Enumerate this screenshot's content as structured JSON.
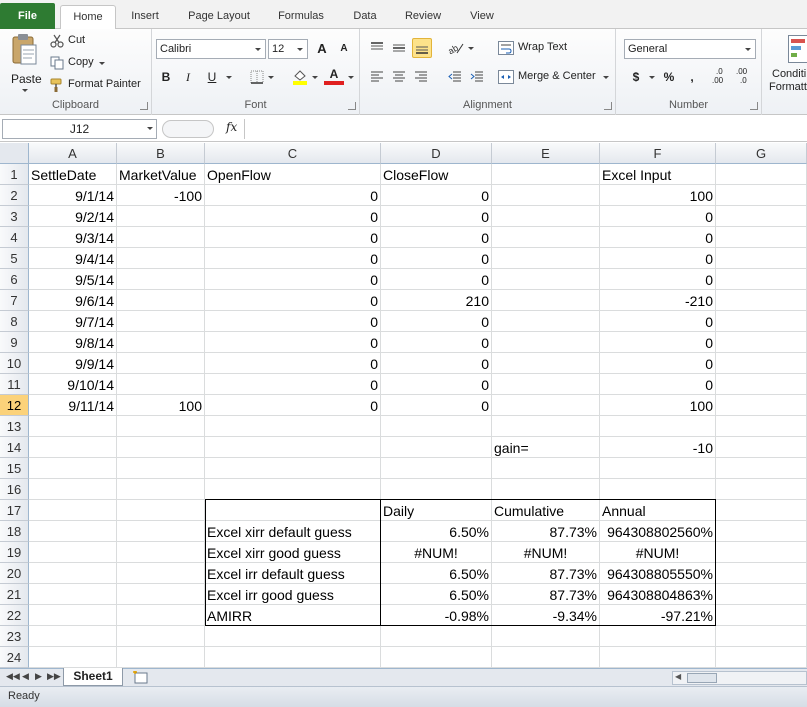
{
  "tabs": [
    "File",
    "Home",
    "Insert",
    "Page Layout",
    "Formulas",
    "Data",
    "Review",
    "View"
  ],
  "active_tab": "Home",
  "ribbon": {
    "clipboard": {
      "paste": "Paste",
      "cut": "Cut",
      "copy": "Copy",
      "format_painter": "Format Painter",
      "label": "Clipboard"
    },
    "font": {
      "name": "Calibri",
      "size": "12",
      "grow": "A",
      "shrink": "A",
      "bold": "B",
      "italic": "I",
      "underline": "U",
      "font_color": "A",
      "label": "Font"
    },
    "alignment": {
      "wrap_text": "Wrap Text",
      "merge_center": "Merge & Center",
      "label": "Alignment"
    },
    "number": {
      "format": "General",
      "currency": "$",
      "percent": "%",
      "comma": ",",
      "inc_decimal": ".00",
      "dec_decimal": ".0",
      "label": "Number"
    },
    "styles": {
      "conditional": "Conditi",
      "formatting": "Formatti"
    }
  },
  "formula_bar": {
    "name_box": "J12",
    "fx": "fx",
    "formula": ""
  },
  "columns": [
    "A",
    "B",
    "C",
    "D",
    "E",
    "F",
    "G"
  ],
  "rows": [
    "1",
    "2",
    "3",
    "4",
    "5",
    "6",
    "7",
    "8",
    "9",
    "10",
    "11",
    "12",
    "13",
    "14",
    "15",
    "16",
    "17",
    "18",
    "19",
    "20",
    "21",
    "22",
    "23",
    "24"
  ],
  "selected_row": "12",
  "cells": {
    "A1": "SettleDate",
    "B1": "MarketValue",
    "C1": "OpenFlow",
    "D1": "CloseFlow",
    "F1": "Excel Input",
    "A2": "9/1/14",
    "B2": "-100",
    "C2": "0",
    "D2": "0",
    "F2": "100",
    "A3": "9/2/14",
    "C3": "0",
    "D3": "0",
    "F3": "0",
    "A4": "9/3/14",
    "C4": "0",
    "D4": "0",
    "F4": "0",
    "A5": "9/4/14",
    "C5": "0",
    "D5": "0",
    "F5": "0",
    "A6": "9/5/14",
    "C6": "0",
    "D6": "0",
    "F6": "0",
    "A7": "9/6/14",
    "C7": "0",
    "D7": "210",
    "F7": "-210",
    "A8": "9/7/14",
    "C8": "0",
    "D8": "0",
    "F8": "0",
    "A9": "9/8/14",
    "C9": "0",
    "D9": "0",
    "F9": "0",
    "A10": "9/9/14",
    "C10": "0",
    "D10": "0",
    "F10": "0",
    "A11": "9/10/14",
    "C11": "0",
    "D11": "0",
    "F11": "0",
    "A12": "9/11/14",
    "B12": "100",
    "C12": "0",
    "D12": "0",
    "F12": "100",
    "E14": "gain=",
    "F14": "-10",
    "D17": "Daily",
    "E17": "Cumulative",
    "F17": "Annual",
    "C18": "Excel xirr default guess",
    "D18": "6.50%",
    "E18": "87.73%",
    "F18": "964308802560%",
    "C19": "Excel xirr good guess",
    "D19": "#NUM!",
    "E19": "#NUM!",
    "F19": "#NUM!",
    "C20": "Excel irr default guess",
    "D20": "6.50%",
    "E20": "87.73%",
    "F20": "964308805550%",
    "C21": "Excel irr good guess",
    "D21": "6.50%",
    "E21": "87.73%",
    "F21": "964308804863%",
    "C22": "AMIRR",
    "D22": "-0.98%",
    "E22": "-9.34%",
    "F22": "-97.21%"
  },
  "sheet_tab": "Sheet1",
  "status": "Ready",
  "colors": {
    "file_tab": "#2e7b32",
    "selected_header": "#fbd27a",
    "gridline": "#dadcdd"
  }
}
